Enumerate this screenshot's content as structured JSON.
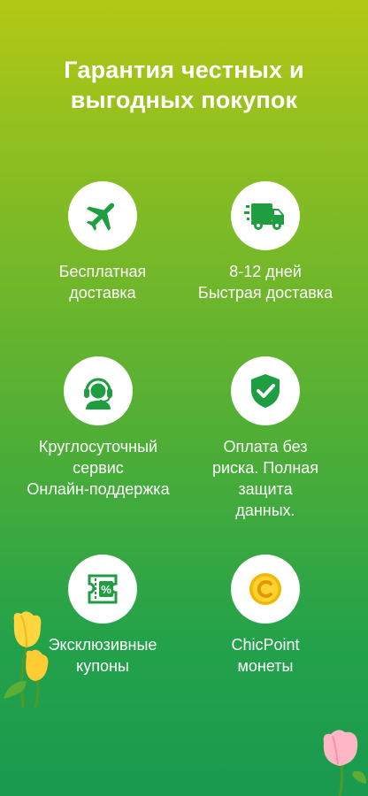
{
  "title": {
    "line1": "Гарантия честных и",
    "line2": "выгодных покупок"
  },
  "features": [
    {
      "icon": "airplane-icon",
      "lines": [
        "Бесплатная",
        "доставка"
      ]
    },
    {
      "icon": "delivery-truck-icon",
      "lines": [
        "8-12 дней",
        "Быстрая доставка"
      ]
    },
    {
      "icon": "headset-support-icon",
      "lines": [
        "Круглосуточный",
        "сервис",
        "Онлайн-поддержка"
      ]
    },
    {
      "icon": "shield-check-icon",
      "lines": [
        "Оплата без",
        "риска. Полная",
        "защита",
        "данных."
      ]
    },
    {
      "icon": "coupon-percent-icon",
      "lines": [
        "Эксклюзивные",
        "купоны"
      ]
    },
    {
      "icon": "coin-icon",
      "lines": [
        "ChicPoint",
        "монеты"
      ]
    }
  ],
  "colors": {
    "accent_green": "#1e9e41",
    "coin_gold": "#f3b700",
    "background_top": "#b3c814",
    "background_bottom": "#1a9a4f"
  }
}
